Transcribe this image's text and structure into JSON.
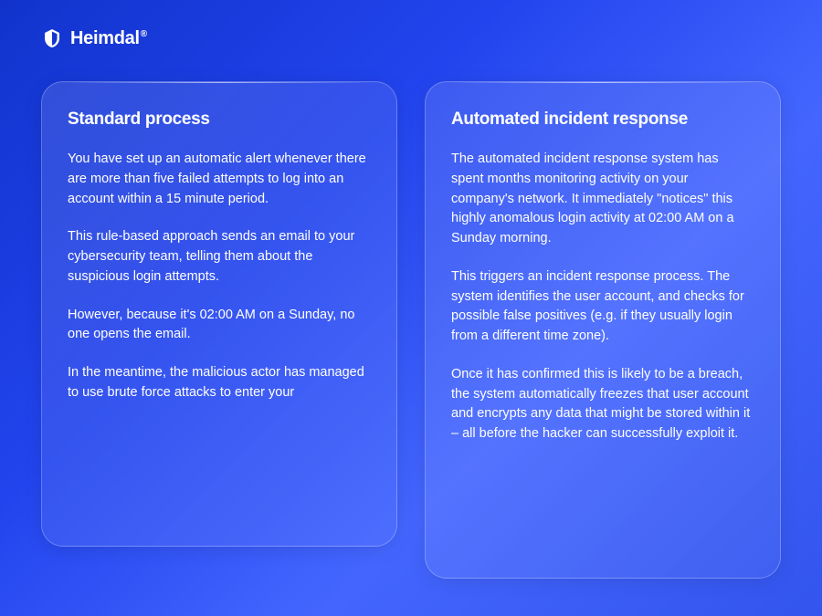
{
  "brand": {
    "name": "Heimdal",
    "registered_mark": "®"
  },
  "cards": {
    "left": {
      "title": "Standard process",
      "paragraphs": [
        "You have set up an automatic alert whenever there are more than five failed attempts to log into an account within a 15 minute period.",
        "This rule-based approach sends an email to your cybersecurity team, telling them about the suspicious login attempts.",
        "However, because it's 02:00 AM on a Sunday, no one opens the email.",
        "In the meantime, the malicious actor has managed to use brute force attacks to enter your"
      ]
    },
    "right": {
      "title": "Automated incident response",
      "paragraphs": [
        "The automated incident response system has spent months monitoring activity on your company's network. It immediately \"notices\" this highly anomalous login activity at 02:00 AM on a Sunday morning.",
        "This triggers an incident response process. The system identifies the user account, and checks for possible false positives (e.g. if they usually login from a different time zone).",
        "Once it has confirmed this is likely to be a breach, the system automatically freezes that user account and encrypts any data that might be stored within it – all before the hacker can successfully exploit it."
      ]
    }
  }
}
